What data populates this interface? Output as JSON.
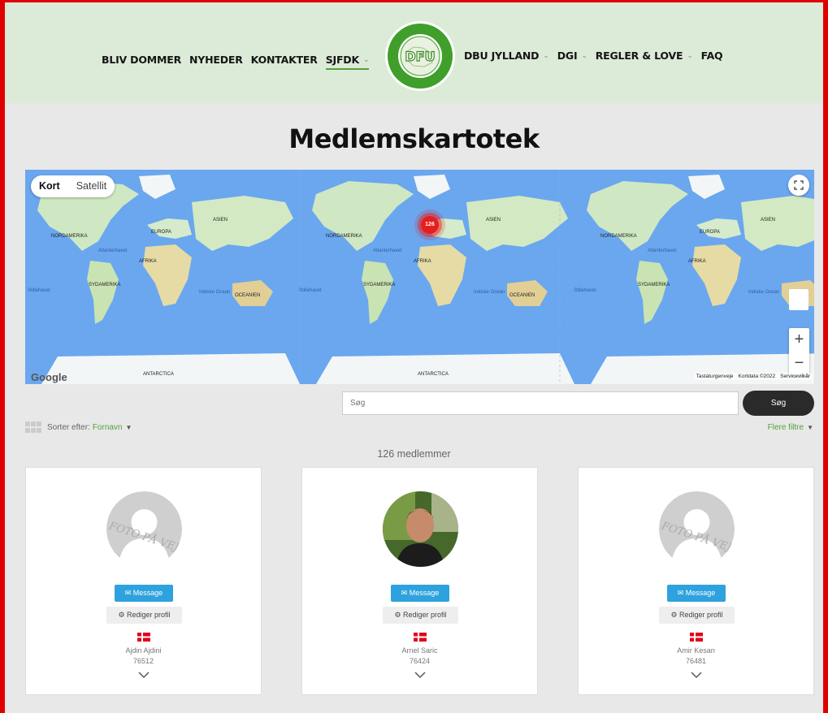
{
  "nav": {
    "left": [
      {
        "label": "BLIV DOMMER"
      },
      {
        "label": "NYHEDER"
      },
      {
        "label": "KONTAKTER"
      },
      {
        "label": "SJFDK"
      }
    ],
    "right": [
      {
        "label": "DBU JYLLAND"
      },
      {
        "label": "DGI"
      },
      {
        "label": "REGLER & LOVE"
      },
      {
        "label": "FAQ"
      }
    ],
    "logo_text": "DFU",
    "logo_ring_text": "SØNDERJYSK FODBOLDDOMMERKLUB"
  },
  "page_title": "Medlemskartotek",
  "map": {
    "type_buttons": {
      "map": "Kort",
      "satellite": "Satellit"
    },
    "cluster_count": "126",
    "attribution": "Google",
    "footer": {
      "shortcuts": "Tastaturgenveje",
      "data": "Kortdata ©2022",
      "terms": "Servicevilkår"
    },
    "labels": {
      "na": "NORDAMERIKA",
      "sa": "SYDAMERIKA",
      "eu": "EUROPA",
      "af": "AFRIKA",
      "as": "ASIEN",
      "oc": "OCEANIEN",
      "an": "ANTARCTICA",
      "atl": "Atlanterhavet",
      "pac": "Stillehavet",
      "ind": "Indiske Ocean"
    }
  },
  "search": {
    "placeholder": "Søg",
    "button": "Søg"
  },
  "sort": {
    "label": "Sorter efter:",
    "value": "Fornavn",
    "more_filters": "Flere filtre"
  },
  "member_count": "126 medlemmer",
  "members": [
    {
      "name": "Ajdin Ajdini",
      "number": "76512",
      "message": "Message",
      "edit": "Rediger profil",
      "placeholder_text": "FOTO PÅ VEJ"
    },
    {
      "name": "Arnel Saric",
      "number": "76424",
      "message": "Message",
      "edit": "Rediger profil"
    },
    {
      "name": "Amir Kesan",
      "number": "76481",
      "message": "Message",
      "edit": "Rediger profil",
      "placeholder_text": "FOTO PÅ VEJ"
    }
  ],
  "colors": {
    "accent_green": "#56a03a",
    "header_bg": "#dcebd8",
    "message_blue": "#2ea2de",
    "cluster_red": "#e81d1d"
  }
}
